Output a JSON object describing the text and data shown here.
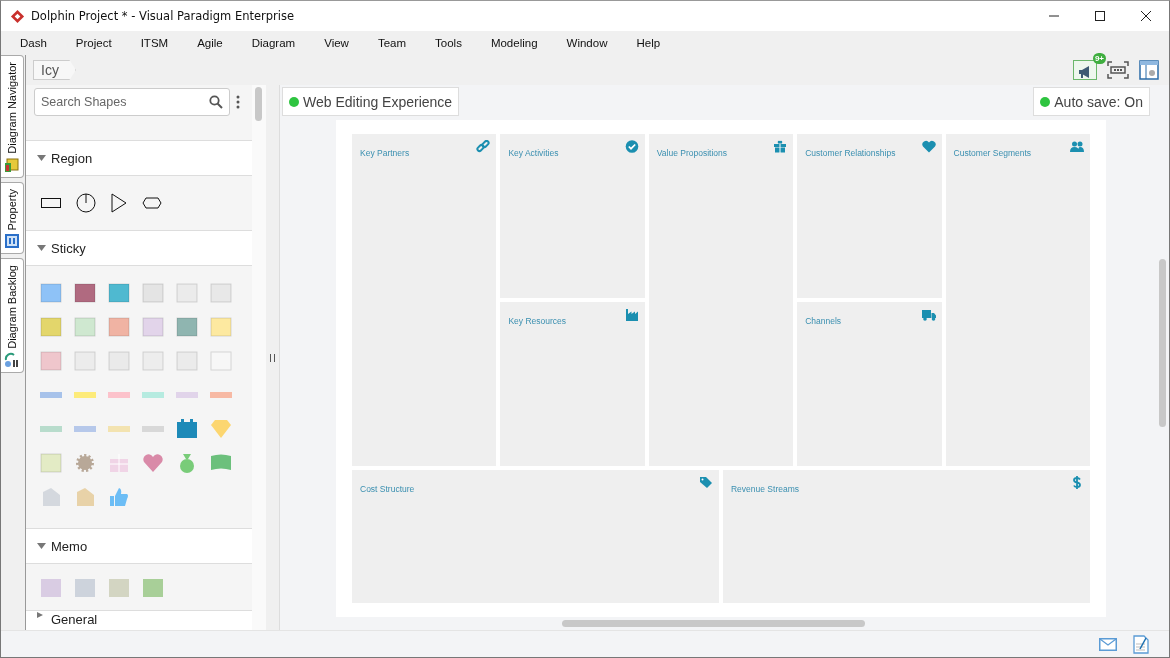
{
  "window": {
    "title": "Dolphin Project * - Visual Paradigm Enterprise"
  },
  "menu": [
    "Dash",
    "Project",
    "ITSM",
    "Agile",
    "Diagram",
    "View",
    "Team",
    "Tools",
    "Modeling",
    "Window",
    "Help"
  ],
  "side_tabs": [
    {
      "label": "Diagram Navigator",
      "selected": false
    },
    {
      "label": "Property",
      "selected": false
    },
    {
      "label": "Diagram Backlog",
      "selected": false
    }
  ],
  "breadcrumb": "Icy",
  "notification_badge": "9+",
  "search": {
    "placeholder": "Search Shapes"
  },
  "palette": [
    {
      "title": "Region",
      "kind": "region",
      "expanded": true
    },
    {
      "title": "Sticky",
      "kind": "sticky",
      "expanded": true
    },
    {
      "title": "Memo",
      "kind": "memo",
      "expanded": true
    },
    {
      "title": "General",
      "expanded": false
    }
  ],
  "status_pills": [
    {
      "label": "Web Editing Experience",
      "color": "#2ec440"
    },
    {
      "label": "Auto save: On",
      "color": "#2ec440"
    }
  ],
  "canvas_blocks": [
    {
      "title": "Key Partners"
    },
    {
      "title": "Key Activities"
    },
    {
      "title": "Value Propositions"
    },
    {
      "title": "Customer Relationships"
    },
    {
      "title": "Customer Segments"
    },
    {
      "title": "Key Resources"
    },
    {
      "title": "Channels"
    },
    {
      "title": "Cost Structure"
    },
    {
      "title": "Revenue Streams"
    }
  ]
}
